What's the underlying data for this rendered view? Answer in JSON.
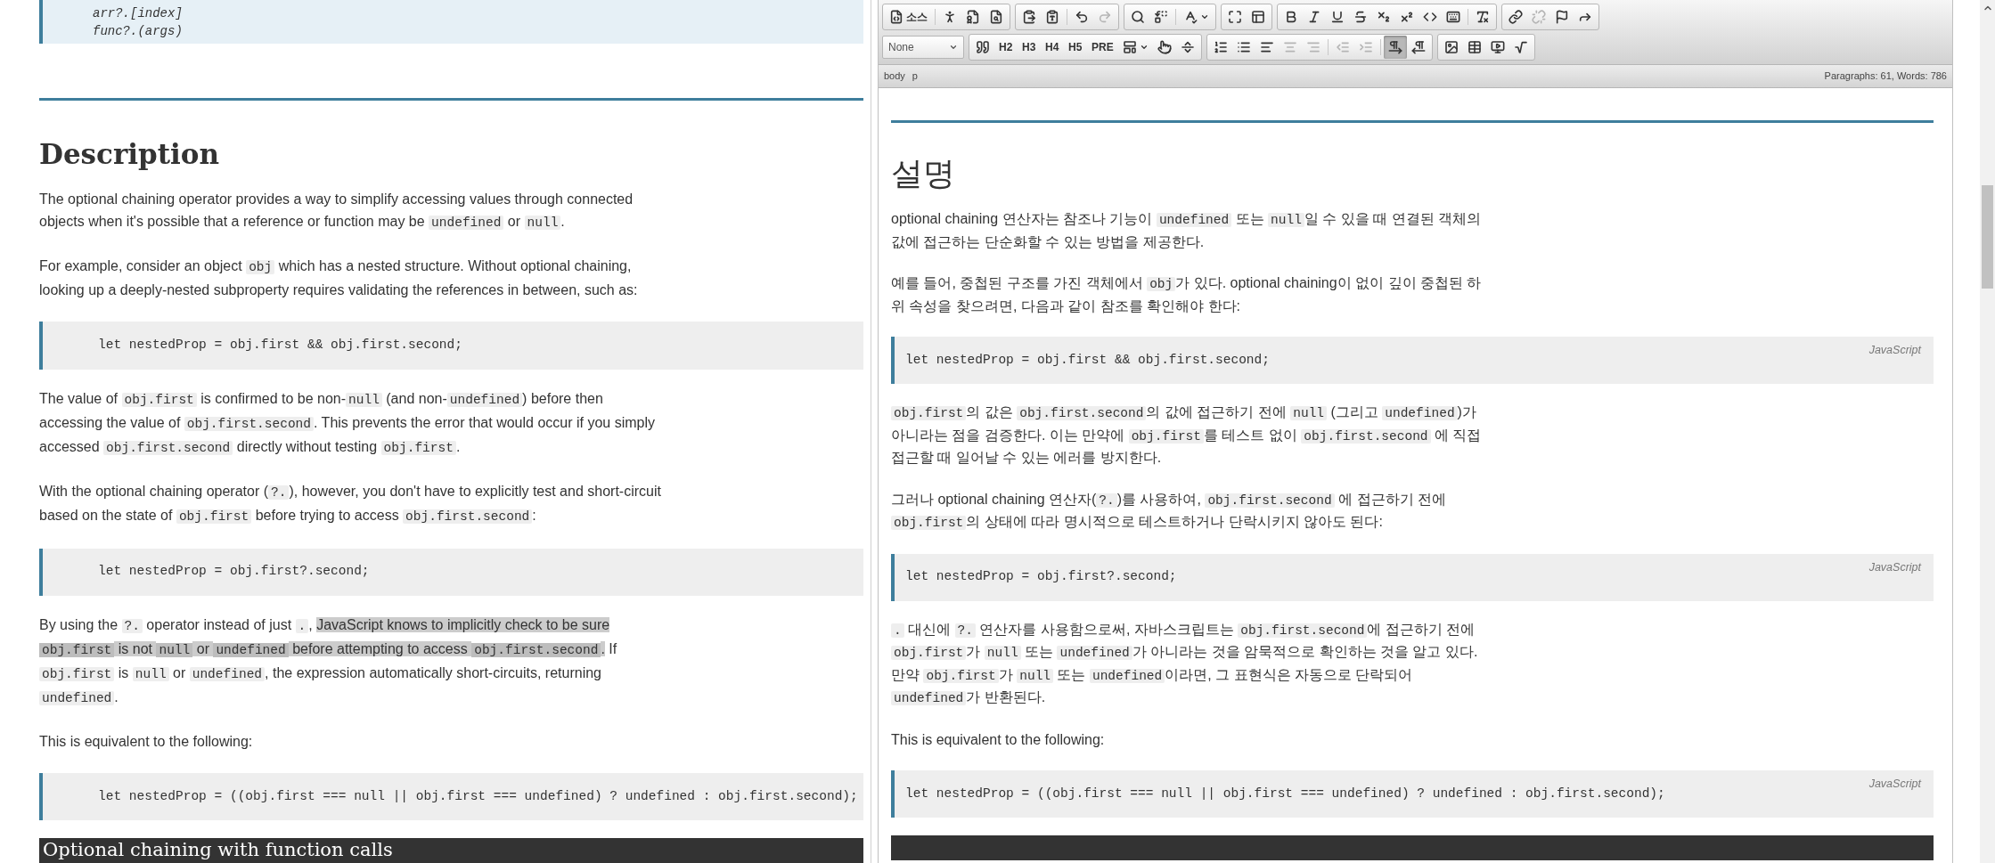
{
  "left": {
    "syntax_lines": [
      "arr?.[index]",
      "func?.(args)"
    ],
    "heading": "Description",
    "blocks": [
      {
        "kind": "paragraph",
        "segments": [
          {
            "kind": "text",
            "text": "The optional chaining operator provides a way to simplify accessing values through connected objects when it's possible that a reference or function may be "
          },
          {
            "kind": "code",
            "text": "undefined"
          },
          {
            "kind": "text",
            "text": " or "
          },
          {
            "kind": "code",
            "text": "null"
          },
          {
            "kind": "text",
            "text": "."
          }
        ]
      },
      {
        "kind": "paragraph",
        "segments": [
          {
            "kind": "text",
            "text": "For example, consider an object "
          },
          {
            "kind": "code",
            "text": "obj"
          },
          {
            "kind": "text",
            "text": " which has a nested structure. Without optional chaining, looking up a deeply-nested subproperty requires validating the references in between, such as:"
          }
        ]
      },
      {
        "kind": "code",
        "code": "let nestedProp = obj.first && obj.first.second;"
      },
      {
        "kind": "paragraph",
        "segments": [
          {
            "kind": "text",
            "text": "The value of "
          },
          {
            "kind": "code",
            "text": "obj.first"
          },
          {
            "kind": "text",
            "text": " is confirmed to be non-"
          },
          {
            "kind": "code",
            "text": "null"
          },
          {
            "kind": "text",
            "text": " (and non-"
          },
          {
            "kind": "code",
            "text": "undefined"
          },
          {
            "kind": "text",
            "text": ") before then accessing the value of "
          },
          {
            "kind": "code",
            "text": "obj.first.second"
          },
          {
            "kind": "text",
            "text": ". This prevents the error that would occur if you simply accessed "
          },
          {
            "kind": "code",
            "text": "obj.first.second"
          },
          {
            "kind": "text",
            "text": " directly without testing "
          },
          {
            "kind": "code",
            "text": "obj.first"
          },
          {
            "kind": "text",
            "text": "."
          }
        ]
      },
      {
        "kind": "paragraph",
        "segments": [
          {
            "kind": "text",
            "text": "With the optional chaining operator ("
          },
          {
            "kind": "code",
            "text": "?."
          },
          {
            "kind": "text",
            "text": "), however, you don't have to explicitly test and short-circuit based on the state of "
          },
          {
            "kind": "code",
            "text": "obj.first"
          },
          {
            "kind": "text",
            "text": " before trying to access "
          },
          {
            "kind": "code",
            "text": "obj.first.second"
          },
          {
            "kind": "text",
            "text": ":"
          }
        ]
      },
      {
        "kind": "code",
        "code": "let nestedProp = obj.first?.second;"
      },
      {
        "kind": "paragraph",
        "segments": [
          {
            "kind": "text",
            "text": "By using the "
          },
          {
            "kind": "code",
            "text": "?."
          },
          {
            "kind": "text",
            "text": " operator instead of just "
          },
          {
            "kind": "code",
            "text": "."
          },
          {
            "kind": "text",
            "text": ", "
          },
          {
            "kind": "mark",
            "text": "JavaScript knows to implicitly check to be sure "
          },
          {
            "kind": "markcode",
            "text": "obj.first"
          },
          {
            "kind": "mark",
            "text": " is not "
          },
          {
            "kind": "markcode",
            "text": "null"
          },
          {
            "kind": "mark",
            "text": " or "
          },
          {
            "kind": "markcode",
            "text": "undefined"
          },
          {
            "kind": "mark",
            "text": " before attempting to access "
          },
          {
            "kind": "markcode",
            "text": "obj.first.second"
          },
          {
            "kind": "mark",
            "text": "."
          },
          {
            "kind": "text",
            "text": " If "
          },
          {
            "kind": "code",
            "text": "obj.first"
          },
          {
            "kind": "text",
            "text": " is "
          },
          {
            "kind": "code",
            "text": "null"
          },
          {
            "kind": "text",
            "text": " or "
          },
          {
            "kind": "code",
            "text": "undefined"
          },
          {
            "kind": "text",
            "text": ", the expression automatically short-circuits, returning "
          },
          {
            "kind": "code",
            "text": "undefined"
          },
          {
            "kind": "text",
            "text": "."
          }
        ]
      },
      {
        "kind": "paragraph",
        "segments": [
          {
            "kind": "text",
            "text": "This is equivalent to the following:"
          }
        ]
      },
      {
        "kind": "code",
        "code": "let nestedProp = ((obj.first === null || obj.first === undefined) ? undefined : obj.first.second);"
      },
      {
        "kind": "section",
        "text": "Optional chaining with function calls"
      }
    ]
  },
  "editor": {
    "toolbar": {
      "rows": [
        {
          "groups": [
            [
              [
                {
                  "kind": "source",
                  "label": "소스",
                  "disabled": false,
                  "active": false
                }
              ],
              [
                {
                  "kind": "accessibility",
                  "disabled": false,
                  "active": false
                },
                {
                  "kind": "check",
                  "disabled": false,
                  "active": false
                },
                {
                  "kind": "preview",
                  "disabled": false,
                  "active": false
                }
              ]
            ],
            [
              [
                {
                  "kind": "paste",
                  "disabled": false,
                  "active": false
                },
                {
                  "kind": "pastetext",
                  "disabled": false,
                  "active": false
                }
              ],
              [
                {
                  "kind": "undo",
                  "disabled": false,
                  "active": false
                },
                {
                  "kind": "redo",
                  "disabled": true,
                  "active": false
                }
              ]
            ],
            [
              [
                {
                  "kind": "find",
                  "disabled": false,
                  "active": false
                },
                {
                  "kind": "replace",
                  "disabled": false,
                  "active": false
                }
              ],
              [
                {
                  "kind": "spellcheck",
                  "disabled": false,
                  "active": false
                }
              ]
            ],
            [
              [
                {
                  "kind": "maximize",
                  "disabled": false,
                  "active": false
                },
                {
                  "kind": "blocks",
                  "disabled": false,
                  "active": false
                }
              ]
            ],
            [
              [
                {
                  "kind": "bold",
                  "disabled": false,
                  "active": false
                },
                {
                  "kind": "italic",
                  "disabled": false,
                  "active": false
                },
                {
                  "kind": "underline",
                  "disabled": false,
                  "active": false
                },
                {
                  "kind": "strike",
                  "disabled": false,
                  "active": false
                },
                {
                  "kind": "subscript",
                  "disabled": false,
                  "active": false
                },
                {
                  "kind": "superscript",
                  "disabled": false,
                  "active": false
                },
                {
                  "kind": "code",
                  "disabled": false,
                  "active": false
                },
                {
                  "kind": "keyboard",
                  "disabled": false,
                  "active": false
                }
              ],
              [
                {
                  "kind": "removeformat",
                  "disabled": false,
                  "active": false
                }
              ]
            ],
            [
              [
                {
                  "kind": "link",
                  "disabled": false,
                  "active": false
                },
                {
                  "kind": "unlink",
                  "disabled": true,
                  "active": false
                },
                {
                  "kind": "anchor",
                  "disabled": false,
                  "active": false
                },
                {
                  "kind": "forward",
                  "disabled": false,
                  "active": false
                }
              ]
            ]
          ]
        },
        {
          "format_value": "None",
          "groups": [
            [
              [
                {
                  "kind": "quote",
                  "disabled": false,
                  "active": false
                },
                {
                  "kind": "heading",
                  "label": "H2",
                  "disabled": false,
                  "active": false
                },
                {
                  "kind": "heading",
                  "label": "H3",
                  "disabled": false,
                  "active": false
                },
                {
                  "kind": "heading",
                  "label": "H4",
                  "disabled": false,
                  "active": false
                },
                {
                  "kind": "heading",
                  "label": "H5",
                  "disabled": false,
                  "active": false
                },
                {
                  "kind": "pre",
                  "label": "PRE",
                  "disabled": false,
                  "active": false
                },
                {
                  "kind": "template",
                  "disabled": false,
                  "active": false
                },
                {
                  "kind": "pointer",
                  "disabled": false,
                  "active": false
                },
                {
                  "kind": "pagebreak",
                  "disabled": false,
                  "active": false
                }
              ]
            ],
            [
              [
                {
                  "kind": "numberedlist",
                  "disabled": false,
                  "active": false
                },
                {
                  "kind": "bulletedlist",
                  "disabled": false,
                  "active": false
                },
                {
                  "kind": "alignleft",
                  "disabled": false,
                  "active": false
                },
                {
                  "kind": "aligncenter",
                  "disabled": true,
                  "active": false
                },
                {
                  "kind": "alignright",
                  "disabled": true,
                  "active": false
                }
              ],
              [
                {
                  "kind": "outdent",
                  "disabled": true,
                  "active": false
                },
                {
                  "kind": "indent",
                  "disabled": true,
                  "active": false
                }
              ],
              [
                {
                  "kind": "ltr",
                  "disabled": false,
                  "active": true
                },
                {
                  "kind": "rtl",
                  "disabled": false,
                  "active": false
                }
              ]
            ],
            [
              [
                {
                  "kind": "image",
                  "disabled": false,
                  "active": false
                },
                {
                  "kind": "table",
                  "disabled": false,
                  "active": false
                },
                {
                  "kind": "video",
                  "disabled": false,
                  "active": false
                },
                {
                  "kind": "math",
                  "disabled": false,
                  "active": false
                }
              ]
            ]
          ]
        }
      ]
    },
    "path": [
      "body",
      "p"
    ],
    "counts": "Paragraphs: 61, Words: 786",
    "heading": "설명",
    "blocks": [
      {
        "kind": "paragraph",
        "segments": [
          {
            "kind": "text",
            "text": "optional chaining 연산자는 참조나 기능이 "
          },
          {
            "kind": "code",
            "text": "undefined"
          },
          {
            "kind": "text",
            "text": " 또는 "
          },
          {
            "kind": "code",
            "text": "null"
          },
          {
            "kind": "text",
            "text": "일 수 있을 때 연결된 객체의 값에 접근하는 단순화할 수 있는 방법을 제공한다."
          }
        ]
      },
      {
        "kind": "paragraph",
        "segments": [
          {
            "kind": "text",
            "text": "예를 들어, 중첩된 구조를 가진 객체에서 "
          },
          {
            "kind": "code",
            "text": "obj"
          },
          {
            "kind": "text",
            "text": "가 있다. optional chaining이 없이 깊이 중첩된 하위 속성을 찾으려면, 다음과 같이 참조를 확인해야 한다:"
          }
        ]
      },
      {
        "kind": "code",
        "code": "let nestedProp = obj.first && obj.first.second;",
        "language": "JavaScript"
      },
      {
        "kind": "paragraph",
        "segments": [
          {
            "kind": "code",
            "text": "obj.first"
          },
          {
            "kind": "text",
            "text": "의 값은 "
          },
          {
            "kind": "code",
            "text": "obj.first.second"
          },
          {
            "kind": "text",
            "text": "의 값에 접근하기 전에 "
          },
          {
            "kind": "code",
            "text": "null"
          },
          {
            "kind": "text",
            "text": " (그리고 "
          },
          {
            "kind": "code",
            "text": "undefined"
          },
          {
            "kind": "text",
            "text": ")가 아니라는 점을 검증한다. 이는 만약에 "
          },
          {
            "kind": "code",
            "text": "obj.first"
          },
          {
            "kind": "text",
            "text": "를 테스트 없이 "
          },
          {
            "kind": "code",
            "text": "obj.first.second"
          },
          {
            "kind": "text",
            "text": " 에 직접 접근할 때 일어날 수 있는 에러를 방지한다."
          }
        ]
      },
      {
        "kind": "paragraph",
        "segments": [
          {
            "kind": "text",
            "text": "그러나 optional chaining 연산자("
          },
          {
            "kind": "code",
            "text": "?."
          },
          {
            "kind": "text",
            "text": ")를 사용하여, "
          },
          {
            "kind": "code",
            "text": "obj.first.second"
          },
          {
            "kind": "text",
            "text": " 에 접근하기 전에 "
          },
          {
            "kind": "code",
            "text": "obj.first"
          },
          {
            "kind": "text",
            "text": "의 상태에 따라 명시적으로 테스트하거나 단락시키지 않아도 된다:"
          }
        ]
      },
      {
        "kind": "code",
        "code": "let nestedProp = obj.first?.second;",
        "language": "JavaScript"
      },
      {
        "kind": "paragraph",
        "segments": [
          {
            "kind": "code",
            "text": "."
          },
          {
            "kind": "text",
            "text": " 대신에 "
          },
          {
            "kind": "code",
            "text": "?."
          },
          {
            "kind": "text",
            "text": " 연산자를 사용함으로써, 자바스크립트는 "
          },
          {
            "kind": "code",
            "text": "obj.first.second"
          },
          {
            "kind": "text",
            "text": "에 접근하기 전에 "
          },
          {
            "kind": "code",
            "text": "obj.first"
          },
          {
            "kind": "text",
            "text": "가 "
          },
          {
            "kind": "code",
            "text": "null"
          },
          {
            "kind": "text",
            "text": " 또는 "
          },
          {
            "kind": "code",
            "text": "undefined"
          },
          {
            "kind": "text",
            "text": "가 아니라는 것을 암묵적으로 확인하는 것을 알고 있다. 만약 "
          },
          {
            "kind": "code",
            "text": "obj.first"
          },
          {
            "kind": "text",
            "text": "가 "
          },
          {
            "kind": "code",
            "text": "null"
          },
          {
            "kind": "text",
            "text": " 또는 "
          },
          {
            "kind": "code",
            "text": "undefined"
          },
          {
            "kind": "text",
            "text": "이라면, 그 표현식은 자동으로 단락되어 "
          },
          {
            "kind": "code",
            "text": "undefined"
          },
          {
            "kind": "text",
            "text": "가 반환된다."
          }
        ]
      },
      {
        "kind": "paragraph",
        "segments": [
          {
            "kind": "text",
            "text": "This is equivalent to the following:"
          }
        ]
      },
      {
        "kind": "code",
        "code": "let nestedProp = ((obj.first === null || obj.first === undefined) ? undefined : obj.first.second);",
        "language": "JavaScript"
      },
      {
        "kind": "section"
      }
    ]
  }
}
